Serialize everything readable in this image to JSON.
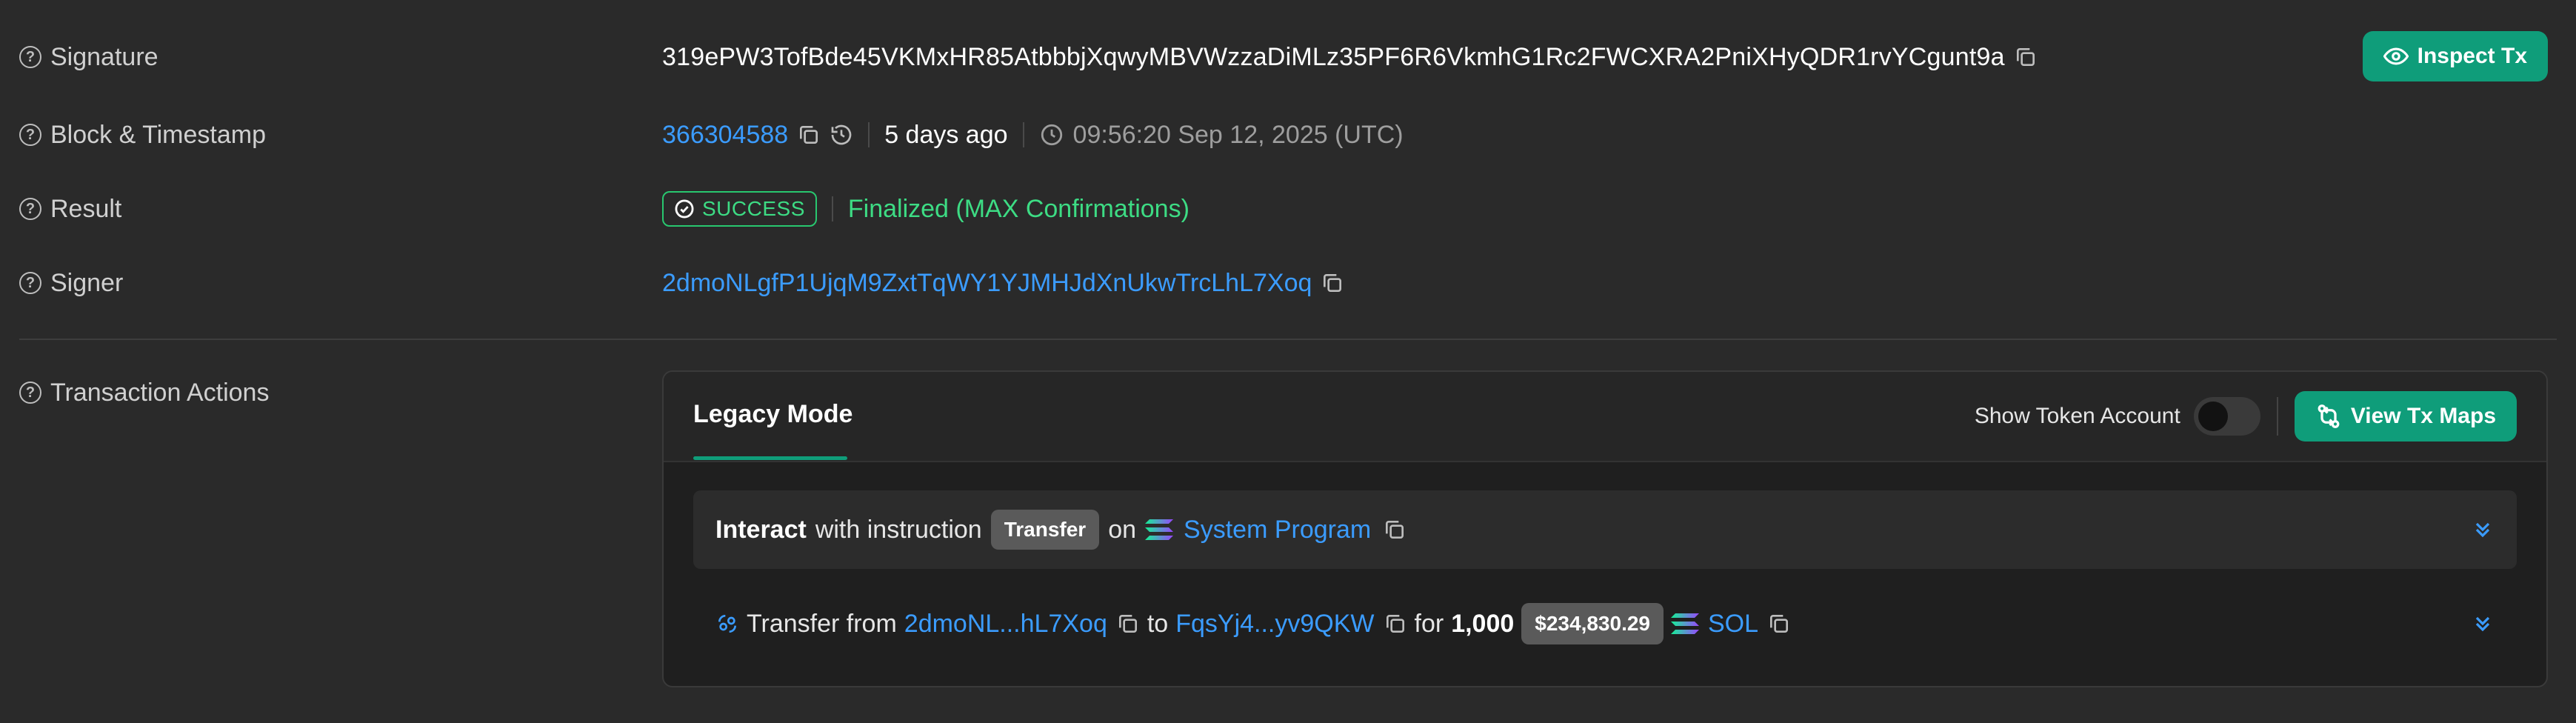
{
  "rows": {
    "signature": {
      "label": "Signature",
      "value": "319ePW3TofBde45VKMxHR85AtbbbjXqwyMBVWzzaDiMLz35PF6R6VkmhG1Rc2FWCXRA2PniXHyQDR1rvYCgunt9a",
      "inspect_button": "Inspect Tx"
    },
    "block": {
      "label": "Block & Timestamp",
      "block_number": "366304588",
      "age": "5 days ago",
      "timestamp": "09:56:20 Sep 12, 2025 (UTC)"
    },
    "result": {
      "label": "Result",
      "badge": "SUCCESS",
      "status": "Finalized (MAX Confirmations)"
    },
    "signer": {
      "label": "Signer",
      "address": "2dmoNLgfP1UjqM9ZxtTqWY1YJMHJdXnUkwTrcLhL7Xoq"
    },
    "actions": {
      "label": "Transaction Actions"
    }
  },
  "panel": {
    "tab": "Legacy Mode",
    "toggle_label": "Show Token Account",
    "view_maps_button": "View Tx Maps",
    "instruction": {
      "prefix": "Interact",
      "middle": "with instruction",
      "chip": "Transfer",
      "on": "on",
      "program": "System Program"
    },
    "transfer": {
      "text_transfer_from": "Transfer from",
      "from": "2dmoNL...hL7Xoq",
      "to_word": "to",
      "to": "FqsYj4...yv9QKW",
      "for_word": "for",
      "amount": "1,000",
      "usd": "$234,830.29",
      "token": "SOL"
    }
  },
  "colors": {
    "accent": "#0f9d7a",
    "link": "#3b9cff",
    "success": "#3ddc84",
    "background": "#2a2a2a"
  }
}
